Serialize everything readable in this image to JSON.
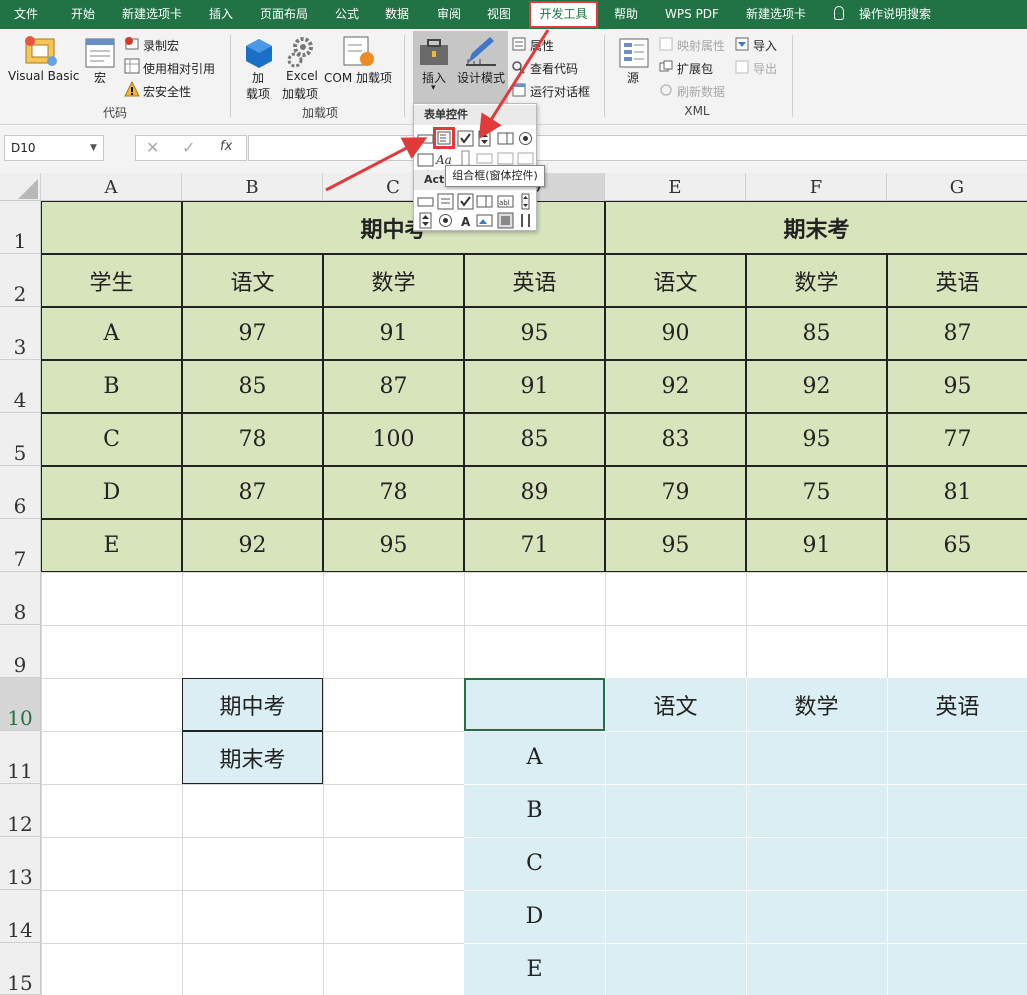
{
  "menu": {
    "tabs": [
      "文件",
      "开始",
      "新建选项卡",
      "插入",
      "页面布局",
      "公式",
      "数据",
      "审阅",
      "视图",
      "开发工具",
      "帮助",
      "WPS PDF",
      "新建选项卡"
    ],
    "active_tab": "开发工具",
    "search_label": "操作说明搜索"
  },
  "ribbon": {
    "code": {
      "visual_basic": "Visual Basic",
      "macro": "宏",
      "record_macro": "录制宏",
      "relative_ref": "使用相对引用",
      "macro_security": "宏安全性",
      "group": "代码"
    },
    "addins": {
      "addin_1": "加",
      "addin_2": "载项",
      "excel_1": "Excel",
      "excel_2": "加载项",
      "com": "COM 加载项",
      "group": "加载项"
    },
    "controls": {
      "insert": "插入",
      "design_mode": "设计模式",
      "properties": "属性",
      "view_code": "查看代码",
      "run_dialog": "运行对话框"
    },
    "xml": {
      "source": "源",
      "map_props": "映射属性",
      "expansion_pack": "扩展包",
      "refresh_data": "刷新数据",
      "import": "导入",
      "export": "导出",
      "group": "XML"
    }
  },
  "formula_bar": {
    "name_box": "D10",
    "fx": "fx"
  },
  "dropdown": {
    "form_controls": "表单控件",
    "activex_controls": "Act",
    "tooltip": "组合框(窗体控件)"
  },
  "columns": [
    "A",
    "B",
    "C",
    "D",
    "E",
    "F",
    "G"
  ],
  "rows": [
    "1",
    "2",
    "3",
    "4",
    "5",
    "6",
    "7",
    "8",
    "9",
    "10",
    "11",
    "12",
    "13",
    "14",
    "15"
  ],
  "table1": {
    "midterm": "期中考",
    "final": "期末考",
    "header_student": "学生",
    "subjects": [
      "语文",
      "数学",
      "英语",
      "语文",
      "数学",
      "英语"
    ],
    "students": [
      "A",
      "B",
      "C",
      "D",
      "E"
    ],
    "scores": [
      [
        "97",
        "91",
        "95",
        "90",
        "85",
        "87"
      ],
      [
        "85",
        "87",
        "91",
        "92",
        "92",
        "95"
      ],
      [
        "78",
        "100",
        "85",
        "83",
        "95",
        "77"
      ],
      [
        "87",
        "78",
        "89",
        "79",
        "75",
        "81"
      ],
      [
        "92",
        "95",
        "71",
        "95",
        "91",
        "65"
      ]
    ]
  },
  "list_box": [
    "期中考",
    "期末考"
  ],
  "table2": {
    "subjects": [
      "语文",
      "数学",
      "英语"
    ],
    "students": [
      "A",
      "B",
      "C",
      "D",
      "E"
    ]
  },
  "colors": {
    "excel_green": "#217346",
    "table_green": "#d8e4bc",
    "table_blue": "#daeef3",
    "highlight_red": "#e23a3a"
  }
}
